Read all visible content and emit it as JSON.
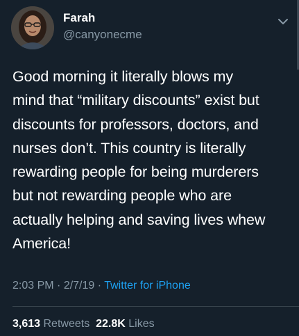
{
  "user": {
    "display_name": "Farah",
    "handle": "@canyonecme",
    "avatar_icon": "user-avatar"
  },
  "tweet": {
    "lines": [
      "Good morning it literally blows my",
      "mind that “military discounts” exist but",
      "discounts for professors, doctors, and",
      "nurses don’t. This country is literally",
      "rewarding people for being murderers",
      "but not rewarding people who are",
      "actually helping and saving lives whew",
      "America!"
    ]
  },
  "meta": {
    "time": "2:03 PM",
    "separator": " · ",
    "date": "2/7/19",
    "source": "Twitter for iPhone"
  },
  "stats": {
    "retweets_count": "3,613",
    "retweets_label": "Retweets",
    "likes_count": "22.8K",
    "likes_label": "Likes"
  },
  "colors": {
    "background": "#15202b",
    "secondary_text": "#8899a6",
    "link": "#1da1f2",
    "divider": "#38444d"
  },
  "icons": {
    "menu": "chevron-down-icon"
  }
}
